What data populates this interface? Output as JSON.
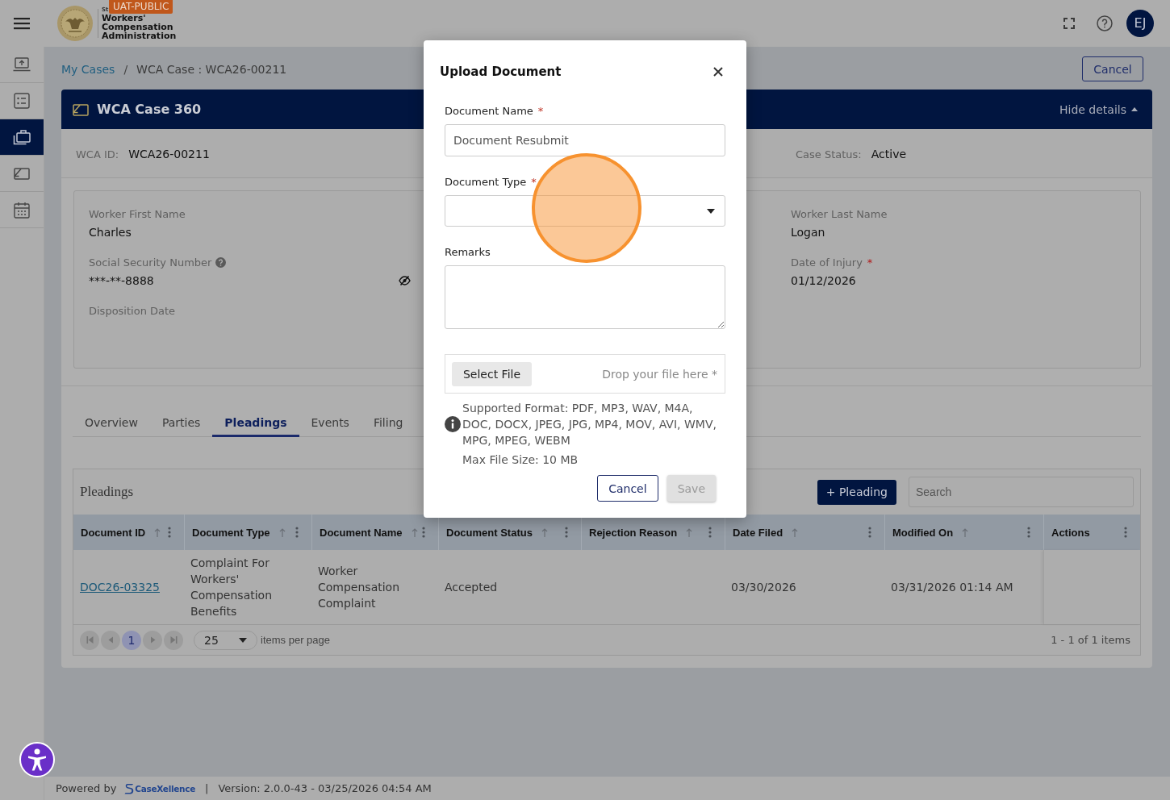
{
  "top_bar": {
    "seal_caption": "St",
    "logo_title": "Workers' Compensation Administration",
    "environment_badge": "UAT-PUBLIC",
    "avatar_initials": "EJ"
  },
  "sidebar": {
    "items": [
      {
        "kind": "upload",
        "selected": false
      },
      {
        "kind": "checklist",
        "selected": false
      },
      {
        "kind": "briefcase",
        "selected": true
      },
      {
        "kind": "card",
        "selected": false
      },
      {
        "kind": "calendar",
        "selected": false
      }
    ]
  },
  "breadcrumb": {
    "items": [
      {
        "label": "My Cases",
        "kind": "link"
      },
      {
        "label": "WCA Case : WCA26-00211",
        "kind": "current"
      }
    ],
    "separator": "/",
    "action": "Cancel"
  },
  "case": {
    "title": "WCA Case 360",
    "toggle": "Hide details",
    "expanded": true,
    "id_label": "WCA ID:",
    "id_value": "WCA26-00211",
    "status_label": "Case Status:",
    "status_value": "Active"
  },
  "details": {
    "left_fields": [
      {
        "label": "Worker First Name",
        "value": "Charles"
      },
      {
        "label": "Social Security Number",
        "value": "***-**-8888",
        "help": true,
        "masked": true
      },
      {
        "label": "Disposition Date"
      }
    ],
    "right_fields": [
      {
        "label": "Worker Last Name",
        "value": "Logan"
      },
      {
        "label": "Date of Injury",
        "required_mark": "*",
        "value": "01/12/2026"
      }
    ]
  },
  "tabs": [
    {
      "label": "Overview",
      "selected": false
    },
    {
      "label": "Parties",
      "selected": false
    },
    {
      "label": "Pleadings",
      "selected": true
    },
    {
      "label": "Events",
      "selected": false
    },
    {
      "label": "Filing",
      "selected": false
    }
  ],
  "pleadings": {
    "title": "Pleadings",
    "add_button": "+ Pleading",
    "search_placeholder": "Search",
    "columns": [
      {
        "label": "Document ID",
        "kind": "link",
        "sortable": true
      },
      {
        "label": "Document Type",
        "kind": "text",
        "sortable": true
      },
      {
        "label": "Document Name",
        "kind": "text",
        "sortable": true
      },
      {
        "label": "Document Status",
        "kind": "text",
        "sortable": true
      },
      {
        "label": "Rejection Reason",
        "kind": "text",
        "sortable": true
      },
      {
        "label": "Date Filed",
        "kind": "text",
        "sortable": true
      },
      {
        "label": "Modified On",
        "kind": "text",
        "sortable": true
      },
      {
        "label": "Actions",
        "kind": "actions",
        "sortable": false
      }
    ],
    "rows": [
      {
        "document_id": "DOC26-03325",
        "document_type": "Complaint For Workers' Compensation Benefits",
        "document_name": "Worker Compensation Complaint",
        "document_status": "Accepted",
        "date_filed": "03/30/2026",
        "modified_on": "03/31/2026 01:14 AM"
      }
    ],
    "pager": {
      "pages": [
        {
          "label": "1",
          "selected": true
        }
      ],
      "page_size": "25",
      "page_size_label": "items per page",
      "summary": "1 - 1 of 1 items"
    }
  },
  "footer": {
    "powered_by": "Powered by",
    "brand": "CaseXellence",
    "separator": "|",
    "version": "Version: 2.0.0-43 - 03/25/2026 04:54 AM"
  },
  "modal": {
    "title": "Upload Document",
    "fields": [
      {
        "kind": "text",
        "label": "Document Name",
        "required_mark": "*",
        "value": "Document Resubmit"
      },
      {
        "kind": "select",
        "label": "Document Type",
        "required_mark": "*"
      },
      {
        "kind": "textarea",
        "label": "Remarks"
      }
    ],
    "file": {
      "button": "Select File",
      "hint": "Drop your file here *"
    },
    "info": {
      "formats": "Supported Format: PDF, MP3, WAV, M4A, DOC, DOCX, JPEG, JPG, MP4, MOV, AVI, WMV, MPG, MPEG, WEBM",
      "max_size": "Max File Size: 10 MB"
    },
    "buttons": [
      {
        "label": "Cancel",
        "kind": "outline",
        "disabled": false
      },
      {
        "label": "Save",
        "kind": "filled",
        "disabled": true
      }
    ]
  }
}
